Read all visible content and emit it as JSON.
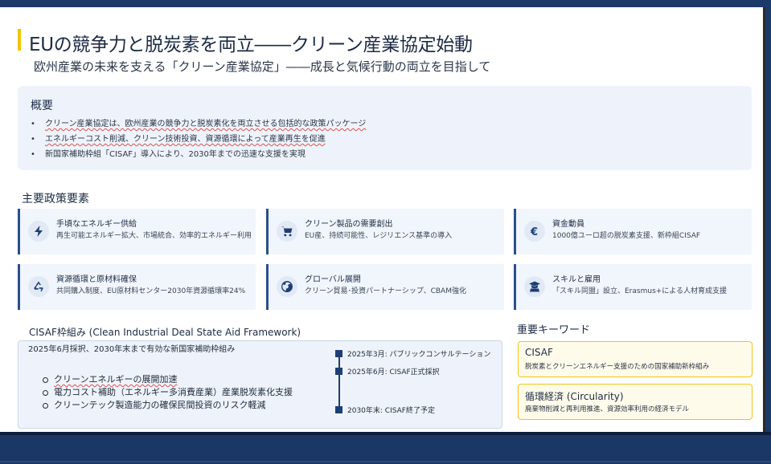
{
  "header": {
    "title": "EUの競争力と脱炭素を両立――クリーン産業協定始動",
    "subtitle": "欧州産業の未来を支える「クリーン産業協定」――成長と気候行動の両立を目指して"
  },
  "overview": {
    "heading": "概要",
    "items": [
      "クリーン産業協定は、欧州産業の競争力と脱炭素化を両立させる包括的な政策パッケージ",
      "エネルギーコスト削減、クリーン技術投資、資源循環によって産業再生を促進",
      "新国家補助枠組「CISAF」導入により、2030年までの迅速な支援を実現"
    ]
  },
  "policies": {
    "heading": "主要政策要素",
    "cards": [
      {
        "icon": "lightning-icon",
        "title": "手頃なエネルギー供給",
        "desc": "再生可能エネルギー拡大、市場統合、効率的エネルギー利用"
      },
      {
        "icon": "cart-icon",
        "title": "クリーン製品の需要創出",
        "desc": "EU産、持続可能性、レジリエンス基準の導入"
      },
      {
        "icon": "euro-icon",
        "title": "資金動員",
        "desc": "1000億ユーロ超の脱炭素支援、新枠組CISAF"
      },
      {
        "icon": "recycle-icon",
        "title": "資源循環と原材料確保",
        "desc": "共同購入制度、EU原材料センター2030年資源循環率24%"
      },
      {
        "icon": "globe-icon",
        "title": "グローバル展開",
        "desc": "クリーン貿易･投資パートナーシップ、CBAM強化"
      },
      {
        "icon": "graduate-icon",
        "title": "スキルと雇用",
        "desc": "「スキル同盟」設立、Erasmus+による人材育成支援"
      }
    ]
  },
  "cisaf": {
    "heading": "CISAF枠組み (Clean Industrial Deal State Aid Framework)",
    "description": "2025年6月採択、2030年末まで有効な新国家補助枠組み",
    "items": [
      "クリーンエネルギーの展開加速",
      "電力コスト補助（エネルギー多消費産業）産業脱炭素化支援",
      "クリーンテック製造能力の確保民間投資のリスク軽減"
    ],
    "timeline": [
      "2025年3月: パブリックコンサルテーション",
      "2025年6月: CISAF正式採択",
      "2030年末: CISAF終了予定"
    ]
  },
  "keywords": {
    "heading": "重要キーワード",
    "items": [
      {
        "term": "CISAF",
        "desc": "脱炭素とクリーンエネルギー支援のための国家補助新枠組み"
      },
      {
        "term": "循環経済 (Circularity)",
        "desc": "廃棄物削減と再利用推進、資源効率利用の経済モデル"
      }
    ]
  },
  "colors": {
    "accent": "#f2c400",
    "navy": "#1c3a69",
    "card_bg": "#f1f5fc",
    "keyword_border": "#f0c419"
  }
}
